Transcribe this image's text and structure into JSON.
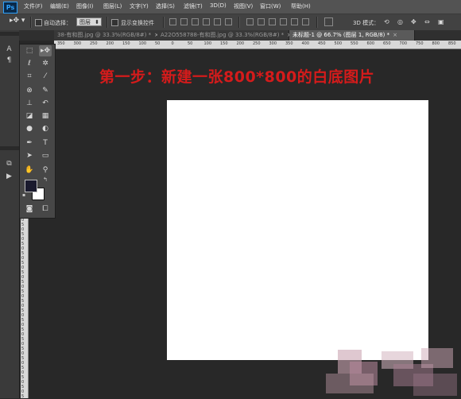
{
  "app": {
    "logo": "Ps",
    "menu": [
      "文件(F)",
      "编辑(E)",
      "图像(I)",
      "图层(L)",
      "文字(Y)",
      "选择(S)",
      "滤镜(T)",
      "3D(D)",
      "视图(V)",
      "窗口(W)",
      "帮助(H)"
    ]
  },
  "options": {
    "auto_select_label": "自动选择：",
    "auto_select_value": "图层",
    "show_transform_label": "显示变换控件",
    "mode_3d_label": "3D 模式："
  },
  "tabs": [
    {
      "label": "38-有和图.jpg @ 33.3%(RGB/8#) *",
      "close": "×"
    },
    {
      "label": "A22O558788-有和图.jpg @ 33.3%(RGB/8#) *",
      "close": "×"
    },
    {
      "label": "未标题-1 @ 66.7% (图层 1, RGB/8) *",
      "close": "×"
    }
  ],
  "ruler_top": [
    "350",
    "300",
    "250",
    "200",
    "150",
    "100",
    "50",
    "0",
    "50",
    "100",
    "150",
    "200",
    "250",
    "300",
    "350",
    "400",
    "450",
    "500",
    "550",
    "600",
    "650",
    "700",
    "750",
    "800",
    "850"
  ],
  "ruler_left": [
    "0",
    "5",
    "0",
    "5",
    "0",
    "5",
    "0",
    "5",
    "0",
    "5",
    "0",
    "5",
    "0",
    "5",
    "0",
    "5",
    "0",
    "5",
    "0",
    "5",
    "0",
    "5",
    "0",
    "5",
    "0",
    "5",
    "0",
    "5",
    "0",
    "5",
    "0",
    "5",
    "0",
    "5",
    "0",
    "5",
    "0",
    "5"
  ],
  "caption": "第一步：新建一张800*800的白底图片",
  "colors": {
    "caption": "#d51b1b",
    "foreground": "#1a1a2e",
    "background": "#ffffff",
    "workspace": "#282828"
  }
}
